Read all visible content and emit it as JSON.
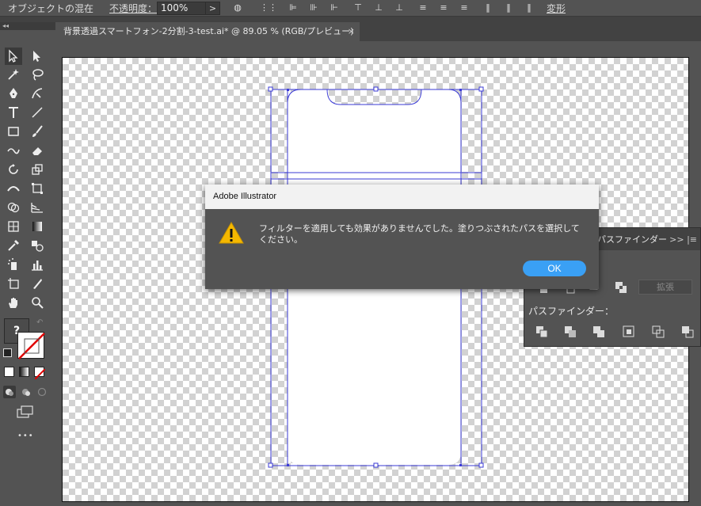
{
  "control_bar": {
    "blend_label": "オブジェクトの混在",
    "opacity_label": "不透明度：",
    "opacity_value": "100%",
    "transform_label": "変形"
  },
  "document_tab": {
    "title": "背景透過スマートフォン-2分割-3-test.ai* @ 89.05 % (RGB/プレビュー)",
    "close": "×"
  },
  "toolbar": {
    "collapse": "◂◂",
    "unknown_fill": "?",
    "more": "•••"
  },
  "dialog": {
    "title": "Adobe Illustrator",
    "message": "フィルターを適用しても効果がありませんでした。塗りつぶされたパスを選択してください。",
    "ok_label": "OK"
  },
  "pathfinder_panel": {
    "tab_label": "パスファインダー",
    "menu_label": ">> |≡",
    "expand_label": "拡張",
    "pathfinder_label": "パスファインダー："
  },
  "colors": {
    "ui_bg": "#535353",
    "accent_ok": "#3aa0f5",
    "selection": "#3b3bd6",
    "warning": "#f5b800"
  }
}
